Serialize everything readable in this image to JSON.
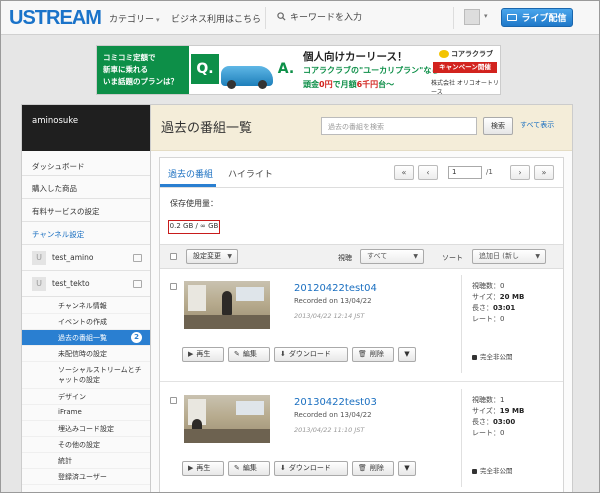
{
  "header": {
    "logo": "USTREAM",
    "nav_category": "カテゴリー",
    "nav_business": "ビジネス利用はこちら",
    "search_placeholder": "キーワードを入力",
    "live_button": "ライブ配信"
  },
  "banner": {
    "left_line1": "コミコミ定額で",
    "left_line2": "新車に乗れる",
    "left_line3": "いま話題のプランは？",
    "q": "Q.",
    "a": "A.",
    "headline": "個人向けカーリース！",
    "line2": "コアラクラブの\"ユーカリプラン\"なら",
    "line3_pre": "頭金",
    "line3_red1": "0円",
    "line3_mid": "で月額",
    "line3_red2": "6千円",
    "line3_post": "台〜",
    "brand": "コアラクラブ",
    "campaign": "キャンペーン開催中！",
    "company": "株式会社 オリコオートリース"
  },
  "sidebar": {
    "username": "aminosuke",
    "items": [
      {
        "label": "ダッシュボード"
      },
      {
        "label": "購入した商品"
      },
      {
        "label": "有料サービスの設定"
      },
      {
        "label": "チャンネル設定"
      }
    ],
    "channels": [
      {
        "initial": "U",
        "name": "test_amino"
      },
      {
        "initial": "U",
        "name": "test_tekto"
      }
    ],
    "subitems": [
      {
        "label": "チャンネル情報"
      },
      {
        "label": "イベントの作成"
      },
      {
        "label": "過去の番組一覧",
        "badge": "2"
      },
      {
        "label": "未配信時の設定"
      },
      {
        "label1": "ソーシャルストリームとチ",
        "label2": "ャットの設定"
      },
      {
        "label": "デザイン"
      },
      {
        "label": "iFrame"
      },
      {
        "label": "埋込みコード設定"
      },
      {
        "label": "その他の設定"
      },
      {
        "label": "統計"
      },
      {
        "label": "登録済ユーザー"
      }
    ]
  },
  "main": {
    "title": "過去の番組一覧",
    "search_placeholder": "過去の番組を検索",
    "search_button": "検索",
    "show_all": "すべて表示",
    "tabs": [
      {
        "label": "過去の番組"
      },
      {
        "label": "ハイライト"
      }
    ],
    "pagination": {
      "first": "«",
      "prev": "‹",
      "page": "1",
      "total": "/1",
      "next": "›",
      "last": "»"
    },
    "storage_label": "保存使用量：",
    "storage_value": "0.2 GB / ∞ GB",
    "toolbar": {
      "settings_button": "設定変更",
      "view_label": "視聴",
      "view_value": "すべて",
      "sort_label": "ソート",
      "sort_value": "追加日 (新し"
    },
    "videos": [
      {
        "title": "20120422test04",
        "recorded": "Recorded on 13/04/22",
        "date": "2013/04/22 12:14 JST",
        "views": "視聴数：0",
        "size_label": "サイズ：",
        "size": "20 MB",
        "length_label": "長さ：",
        "length": "03:01",
        "rate": "レート：0",
        "privacy": "完全非公開"
      },
      {
        "title": "20130422test03",
        "recorded": "Recorded on 13/04/22",
        "date": "2013/04/22 11:10 JST",
        "views": "視聴数：1",
        "size_label": "サイズ：",
        "size": "19 MB",
        "length_label": "長さ：",
        "length": "03:00",
        "rate": "レート：0",
        "privacy": "完全非公開"
      }
    ],
    "actions": {
      "play": "再生",
      "edit": "編集",
      "download": "ダウンロード",
      "delete": "削除"
    }
  },
  "colors": {
    "accent": "#2a7fd1",
    "brand": "#1a73c9",
    "storage_border": "#c81b1b"
  }
}
